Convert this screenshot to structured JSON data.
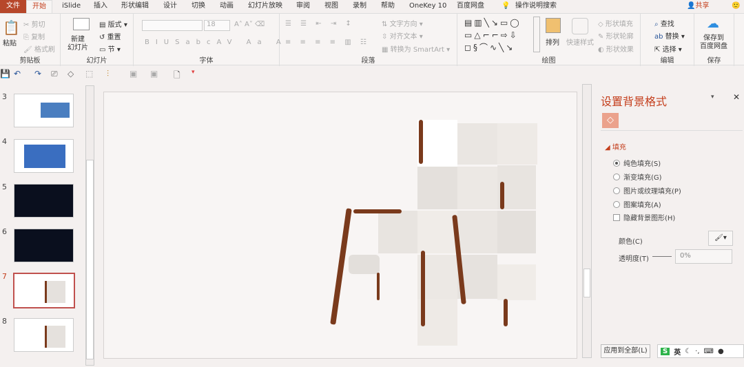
{
  "tabs": {
    "file": "文件",
    "items": [
      "开始",
      "iSlide",
      "插入",
      "形状编辑",
      "设计",
      "切换",
      "动画",
      "幻灯片放映",
      "审阅",
      "视图",
      "录制",
      "帮助",
      "OneKey 10",
      "百度网盘"
    ],
    "search": "操作说明搜索",
    "share": "共享"
  },
  "ribbon": {
    "clipboard": {
      "label": "剪贴板",
      "paste": "粘贴",
      "cut": "剪切",
      "copy": "复制",
      "format_painter": "格式刷"
    },
    "slides": {
      "label": "幻灯片",
      "new_slide": "新建\n幻灯片",
      "layout": "版式",
      "reset": "重置",
      "section": "节"
    },
    "font": {
      "label": "字体",
      "font_name": "",
      "font_size": "18"
    },
    "paragraph": {
      "label": "段落",
      "text_direction": "文字方向",
      "align_text": "对齐文本",
      "smartart": "转换为 SmartArt"
    },
    "drawing": {
      "label": "绘图",
      "arrange": "排列",
      "quick_styles": "快速样式",
      "shape_fill": "形状填充",
      "shape_outline": "形状轮廓",
      "shape_effects": "形状效果"
    },
    "editing": {
      "label": "编辑",
      "find": "查找",
      "replace": "替换",
      "select": "选择"
    },
    "save": {
      "label": "保存",
      "save_to": "保存到\n百度网盘"
    }
  },
  "thumbnails": [
    {
      "num": "3"
    },
    {
      "num": "4"
    },
    {
      "num": "5"
    },
    {
      "num": "6"
    },
    {
      "num": "7",
      "selected": true
    },
    {
      "num": "8"
    }
  ],
  "pane": {
    "title": "设置背景格式",
    "section": "填充",
    "options": [
      "纯色填充(S)",
      "渐变填充(G)",
      "图片或纹理填充(P)",
      "图案填充(A)"
    ],
    "selected": 0,
    "hide_bg": "隐藏背景图形(H)",
    "color_label": "颜色(C)",
    "transparency_label": "透明度(T)",
    "transparency": "0%",
    "apply_all": "应用到全部(L)"
  },
  "ime": {
    "lang": "英"
  },
  "colors": {
    "accent": "#b7472a",
    "wood": "#7a3a1c"
  }
}
